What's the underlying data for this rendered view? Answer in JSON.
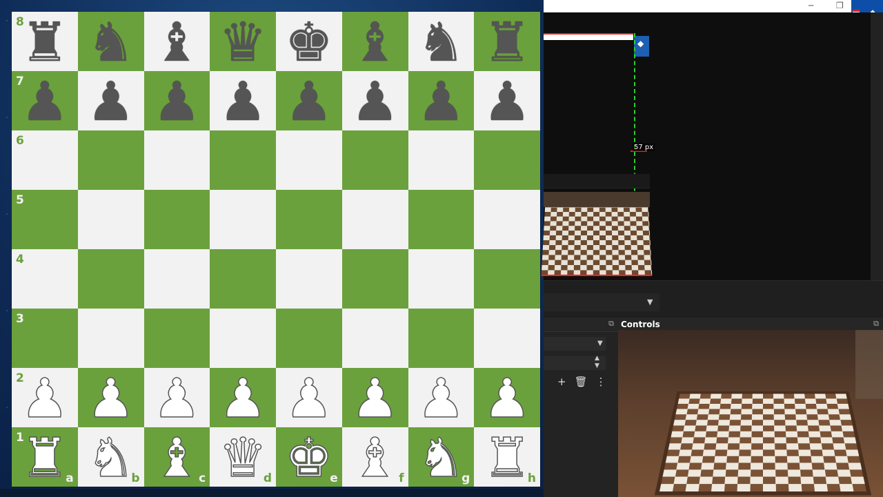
{
  "board": {
    "files": [
      "a",
      "b",
      "c",
      "d",
      "e",
      "f",
      "g",
      "h"
    ],
    "ranks": [
      "8",
      "7",
      "6",
      "5",
      "4",
      "3",
      "2",
      "1"
    ],
    "rows": [
      [
        "br",
        "bn",
        "bb",
        "bq",
        "bk",
        "bb",
        "bn",
        "br"
      ],
      [
        "bp",
        "bp",
        "bp",
        "bp",
        "bp",
        "bp",
        "bp",
        "bp"
      ],
      [
        "",
        "",
        "",
        "",
        "",
        "",
        "",
        ""
      ],
      [
        "",
        "",
        "",
        "",
        "",
        "",
        "",
        ""
      ],
      [
        "",
        "",
        "",
        "",
        "",
        "",
        "",
        ""
      ],
      [
        "",
        "",
        "",
        "",
        "",
        "",
        "",
        ""
      ],
      [
        "wp",
        "wp",
        "wp",
        "wp",
        "wp",
        "wp",
        "wp",
        "wp"
      ],
      [
        "wr",
        "wn",
        "wb",
        "wq",
        "wk",
        "wb",
        "wn",
        "wr"
      ]
    ],
    "colors": {
      "light": "#f2f2f2",
      "dark": "#6aa13c"
    }
  },
  "glyphs": {
    "k": "♚",
    "q": "♛",
    "r": "♜",
    "b": "♝",
    "n": "♞",
    "p": "♟"
  },
  "obs": {
    "distance_label": "57 px",
    "controls_title": "Controls",
    "icons": [
      "minimize-icon",
      "restore-icon",
      "gem-icon",
      "add-icon",
      "trash-icon",
      "more-icon",
      "dropdown-icon",
      "popout-icon"
    ]
  }
}
